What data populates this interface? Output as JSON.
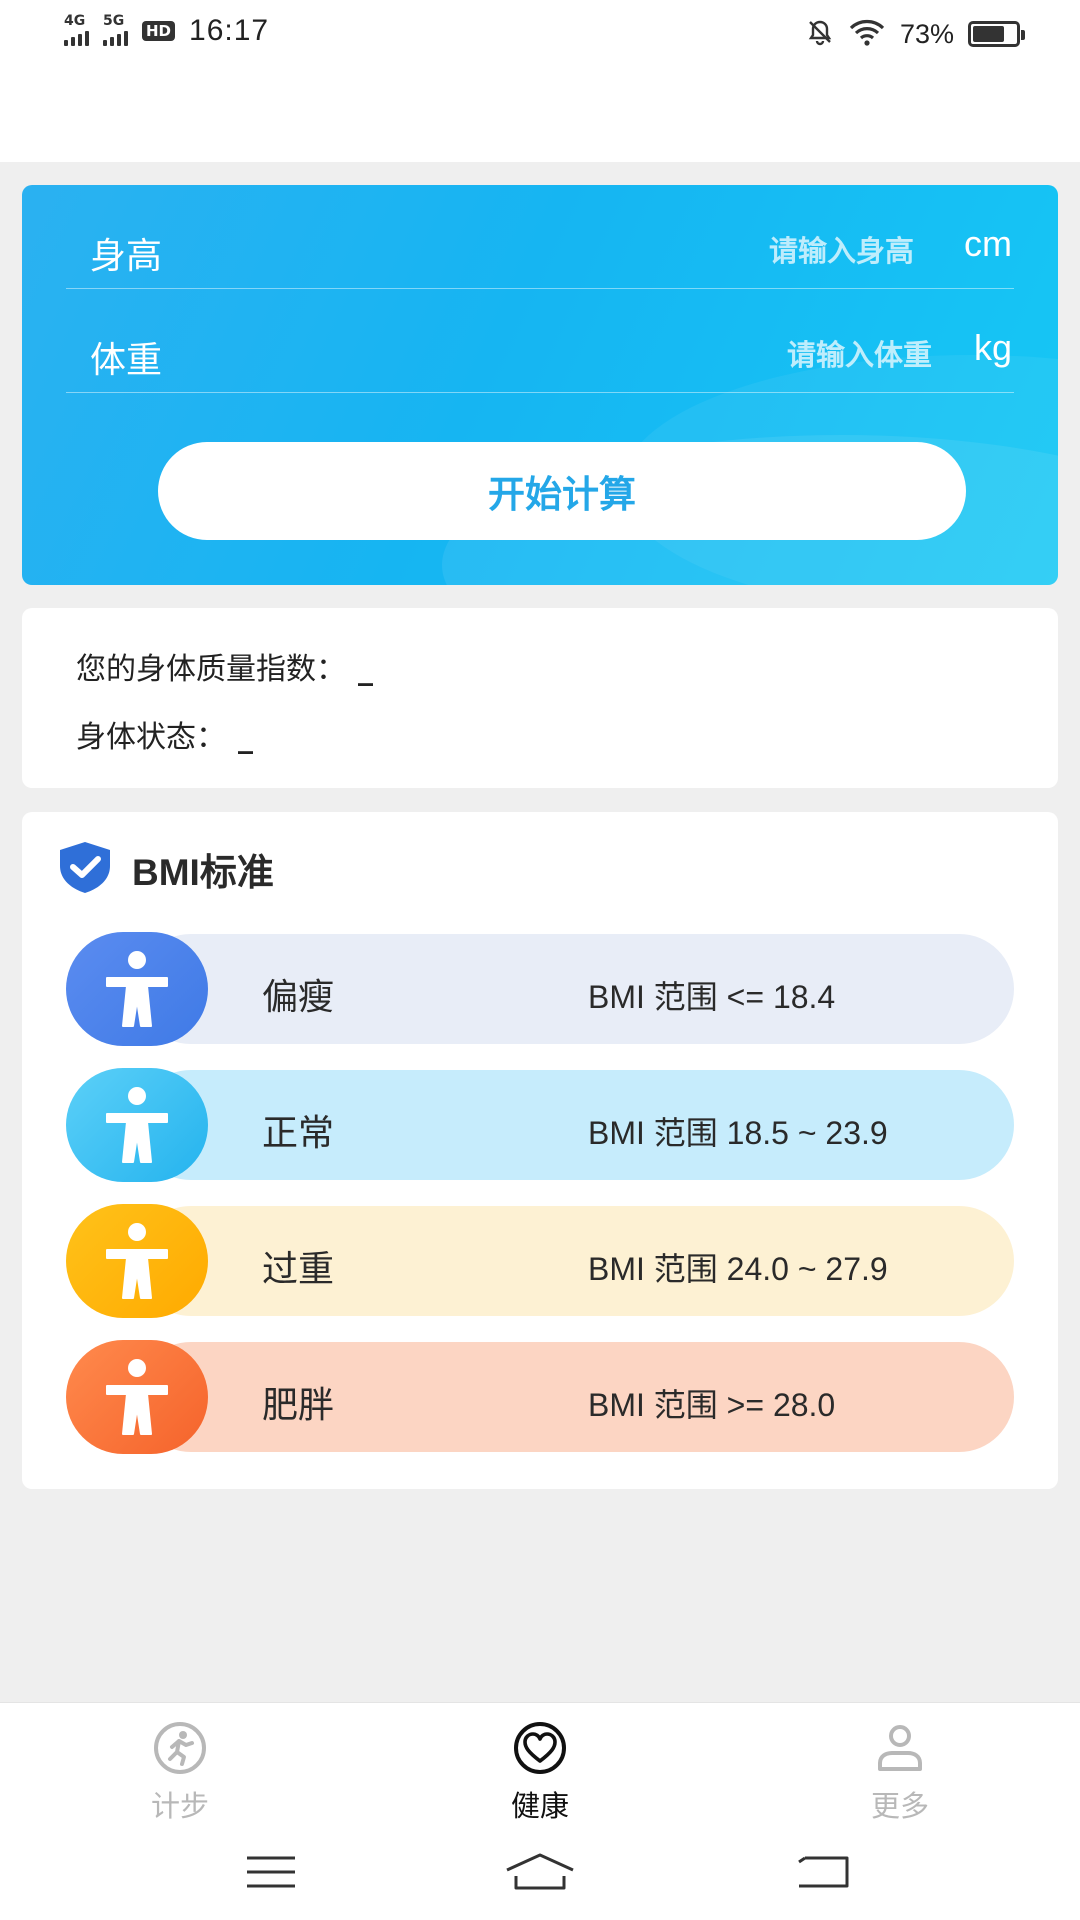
{
  "status_bar": {
    "network_1": "4G",
    "network_2": "5G",
    "hd_badge": "HD",
    "time": "16:17",
    "battery_text": "73%",
    "battery_level": 0.73
  },
  "calculator": {
    "height": {
      "label": "身高",
      "placeholder": "请输入身高",
      "value": "",
      "unit": "cm"
    },
    "weight": {
      "label": "体重",
      "placeholder": "请输入体重",
      "value": "",
      "unit": "kg"
    },
    "button_label": "开始计算"
  },
  "result": {
    "bmi_label": "您的身体质量指数：",
    "bmi_value": "_",
    "status_label": "身体状态：",
    "status_value": "_"
  },
  "standards": {
    "title": "BMI标准",
    "items": [
      {
        "name": "偏瘦",
        "range": "BMI 范围 <= 18.4",
        "circle_color": "#5b8cf0",
        "circle_color_2": "#3f7ae6",
        "pill_color": "#e8edf7"
      },
      {
        "name": "正常",
        "range": "BMI 范围 18.5 ~ 23.9",
        "circle_color": "#5cd0f8",
        "circle_color_2": "#24b3ee",
        "pill_color": "#c6ecfc"
      },
      {
        "name": "过重",
        "range": "BMI 范围 24.0 ~ 27.9",
        "circle_color": "#ffc21a",
        "circle_color_2": "#ffaa00",
        "pill_color": "#fdf1d3"
      },
      {
        "name": "肥胖",
        "range": "BMI 范围 >= 28.0",
        "circle_color": "#ff8a4d",
        "circle_color_2": "#f5632b",
        "pill_color": "#fcd5c3"
      }
    ]
  },
  "tabs": [
    {
      "label": "计步",
      "icon": "running-man-icon",
      "active": false
    },
    {
      "label": "健康",
      "icon": "heart-icon",
      "active": true
    },
    {
      "label": "更多",
      "icon": "user-icon",
      "active": false
    }
  ],
  "colors": {
    "accent": "#24a7e8",
    "tab_active": "#111111",
    "tab_inactive": "#b8b8b8"
  }
}
